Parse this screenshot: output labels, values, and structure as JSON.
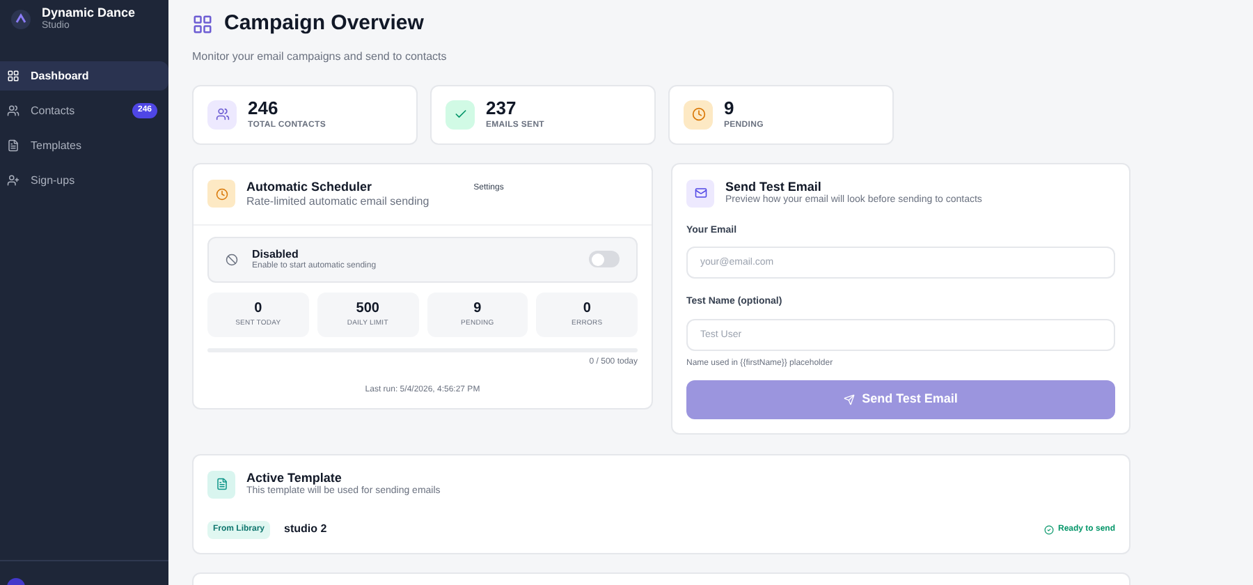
{
  "brand": {
    "name": "Dynamic Dance",
    "subtitle": "Studio"
  },
  "sidebar": {
    "items": [
      {
        "kind": "dashboard",
        "label": "Dashboard",
        "selected": true
      },
      {
        "kind": "contacts",
        "label": "Contacts",
        "selected": false,
        "badge": "246"
      },
      {
        "kind": "templates",
        "label": "Templates",
        "selected": false
      },
      {
        "kind": "signups",
        "label": "Sign-ups",
        "selected": false
      }
    ]
  },
  "header": {
    "title": "Campaign Overview",
    "subtitle": "Monitor your email campaigns and send to contacts"
  },
  "stats": [
    {
      "kind": "contacts",
      "value": "246",
      "label": "TOTAL CONTACTS"
    },
    {
      "kind": "sent",
      "value": "237",
      "label": "EMAILS SENT"
    },
    {
      "kind": "pending",
      "value": "9",
      "label": "PENDING"
    }
  ],
  "scheduler": {
    "title": "Automatic Scheduler",
    "subtitle": "Rate-limited automatic email sending",
    "settings": "Settings",
    "status": {
      "title": "Disabled",
      "hint": "Enable to start automatic sending",
      "on": false
    },
    "metrics": [
      {
        "value": "0",
        "label": "SENT TODAY"
      },
      {
        "value": "500",
        "label": "DAILY LIMIT"
      },
      {
        "value": "9",
        "label": "PENDING"
      },
      {
        "value": "0",
        "label": "ERRORS"
      }
    ],
    "progress": {
      "level": 0,
      "reading": "0 / 500 today"
    },
    "last_run": "Last run: 5/4/2026, 4:56:27 PM"
  },
  "test_email": {
    "title": "Send Test Email",
    "subtitle": "Preview how your email will look before sending to contacts",
    "fields": [
      {
        "label": "Your Email",
        "placeholder": "your@email.com"
      },
      {
        "label": "Test Name (optional)",
        "placeholder": "Test User",
        "hint": "Name used in {{firstName}} placeholder"
      }
    ],
    "button": "Send Test Email"
  },
  "template": {
    "title": "Active Template",
    "subtitle": "This template will be used for sending emails",
    "source": "From Library",
    "name": "studio 2",
    "status": "Ready to send"
  }
}
